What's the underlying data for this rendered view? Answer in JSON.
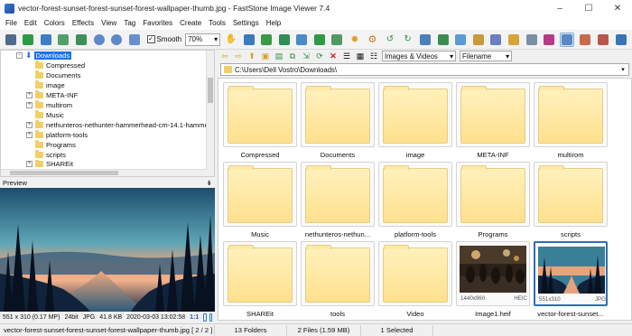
{
  "window": {
    "title": "vector-forest-sunset-forest-sunset-forest-wallpaper-thumb.jpg - FastStone Image Viewer 7.4",
    "minimize": "–",
    "maximize": "☐",
    "close": "✕"
  },
  "menu": [
    "File",
    "Edit",
    "Colors",
    "Effects",
    "View",
    "Tag",
    "Favorites",
    "Create",
    "Tools",
    "Settings",
    "Help"
  ],
  "toolbar": {
    "smooth_label": "Smooth",
    "smooth_checked": true,
    "zoom_value": "70%",
    "colors": {
      "a": "#4a7ab8",
      "b": "#2f9a45",
      "c": "#5f87c9",
      "d": "#4fa06a",
      "e": "#3b78c4",
      "f": "#d8a43a",
      "g": "#c4452f",
      "h": "#7b62c2"
    }
  },
  "tree": {
    "items": [
      {
        "label": "Downloads",
        "selected": true,
        "expander": "-"
      },
      {
        "label": "Compressed",
        "expander": ""
      },
      {
        "label": "Documents",
        "expander": ""
      },
      {
        "label": "image",
        "expander": ""
      },
      {
        "label": "META-INF",
        "expander": "+"
      },
      {
        "label": "multirom",
        "expander": "+"
      },
      {
        "label": "Music",
        "expander": ""
      },
      {
        "label": "nethunteros-nethunter-hammerhead-cm-14.1-hamme",
        "expander": "+"
      },
      {
        "label": "platform-tools",
        "expander": "+"
      },
      {
        "label": "Programs",
        "expander": ""
      },
      {
        "label": "scripts",
        "expander": ""
      },
      {
        "label": "SHAREit",
        "expander": "+"
      }
    ]
  },
  "preview": {
    "label": "Preview",
    "pin": "⇟",
    "status": {
      "dimensions": "551 x 310 (0.17 MP)",
      "bitdepth": "24bit",
      "format": "JPG",
      "size": "41.8 KB",
      "date": "2020-03-03 13:02:58",
      "ratio": "1:1"
    }
  },
  "nav": {
    "filter": "Images & Videos",
    "sort": "Filename",
    "path": "C:\\Users\\Dell Vostro\\Downloads\\"
  },
  "thumbnails": [
    {
      "caption": "Compressed",
      "type": "folder"
    },
    {
      "caption": "Documents",
      "type": "folder"
    },
    {
      "caption": "image",
      "type": "folder"
    },
    {
      "caption": "META-INF",
      "type": "folder"
    },
    {
      "caption": "multirom",
      "type": "folder"
    },
    {
      "caption": "Music",
      "type": "folder"
    },
    {
      "caption": "nethunteros-nethun...",
      "type": "folder"
    },
    {
      "caption": "platform-tools",
      "type": "folder"
    },
    {
      "caption": "Programs",
      "type": "folder"
    },
    {
      "caption": "scripts",
      "type": "folder"
    },
    {
      "caption": "SHAREit",
      "type": "folder"
    },
    {
      "caption": "tools",
      "type": "folder"
    },
    {
      "caption": "Video",
      "type": "folder"
    },
    {
      "caption": "Image1.heif",
      "type": "photo",
      "dims": "1440x960",
      "fmt": "HEIC"
    },
    {
      "caption": "vector-forest-sunset...",
      "type": "photo",
      "dims": "551x310",
      "fmt": "JPG",
      "selected": true
    }
  ],
  "statusbar": {
    "file": "vector-forest-sunset-forest-sunset-forest-wallpaper-thumb.jpg [ 2 / 2 ]",
    "folders": "13 Folders",
    "files": "2 Files (1.59 MB)",
    "selected": "1 Selected"
  }
}
